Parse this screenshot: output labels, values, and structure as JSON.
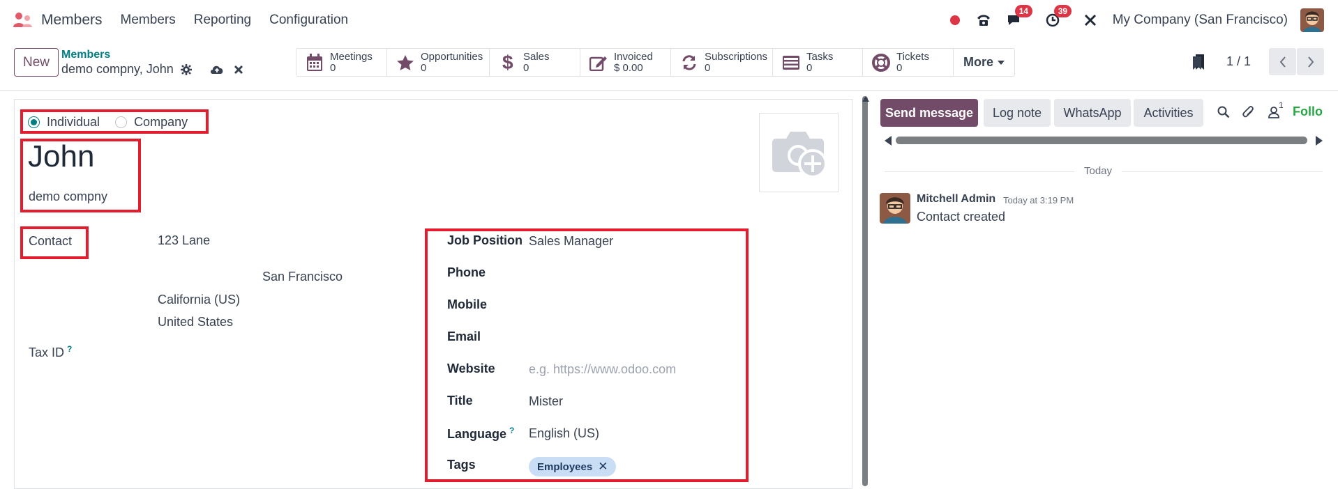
{
  "navbar": {
    "app_name": "Members",
    "menu": [
      "Members",
      "Reporting",
      "Configuration"
    ],
    "messages_badge": "14",
    "activities_badge": "39",
    "company": "My Company (San Francisco)"
  },
  "control_panel": {
    "new_label": "New",
    "breadcrumb_parent": "Members",
    "breadcrumb_current": "demo compny, John",
    "smart_buttons": [
      {
        "label": "Meetings",
        "value": "0",
        "icon": "calendar-icon"
      },
      {
        "label": "Opportunities",
        "value": "0",
        "icon": "star-icon"
      },
      {
        "label": "Sales",
        "value": "0",
        "icon": "dollar-icon"
      },
      {
        "label": "Invoiced",
        "value": "$ 0.00",
        "icon": "edit-icon"
      },
      {
        "label": "Subscriptions",
        "value": "0",
        "icon": "refresh-icon"
      },
      {
        "label": "Tasks",
        "value": "0",
        "icon": "tasks-icon"
      },
      {
        "label": "Tickets",
        "value": "0",
        "icon": "lifebuoy-icon"
      }
    ],
    "more_label": "More",
    "pager": "1 / 1"
  },
  "form": {
    "type_options": [
      "Individual",
      "Company"
    ],
    "selected_type": "Individual",
    "name": "John",
    "company_name": "demo compny",
    "address_label": "Contact",
    "street": "123 Lane",
    "city": "San Francisco",
    "state": "California (US)",
    "country": "United States",
    "tax_id_label": "Tax ID",
    "help_mark": "?",
    "fields": {
      "job_position_label": "Job Position",
      "job_position": "Sales Manager",
      "phone_label": "Phone",
      "mobile_label": "Mobile",
      "email_label": "Email",
      "website_label": "Website",
      "website_placeholder": "e.g. https://www.odoo.com",
      "title_label": "Title",
      "title": "Mister",
      "language_label": "Language",
      "language": "English (US)",
      "tags_label": "Tags",
      "tag": "Employees"
    }
  },
  "chatter": {
    "send_message": "Send message",
    "log_note": "Log note",
    "whatsapp": "WhatsApp",
    "activities": "Activities",
    "followers_count": "1",
    "follow": "Follo",
    "date_divider": "Today",
    "message": {
      "author": "Mitchell Admin",
      "time": "Today at 3:19 PM",
      "body": "Contact created"
    }
  },
  "colors": {
    "brand": "#714b67",
    "teal": "#017e84",
    "highlight": "#e11d2e",
    "badge": "#dc3545"
  }
}
